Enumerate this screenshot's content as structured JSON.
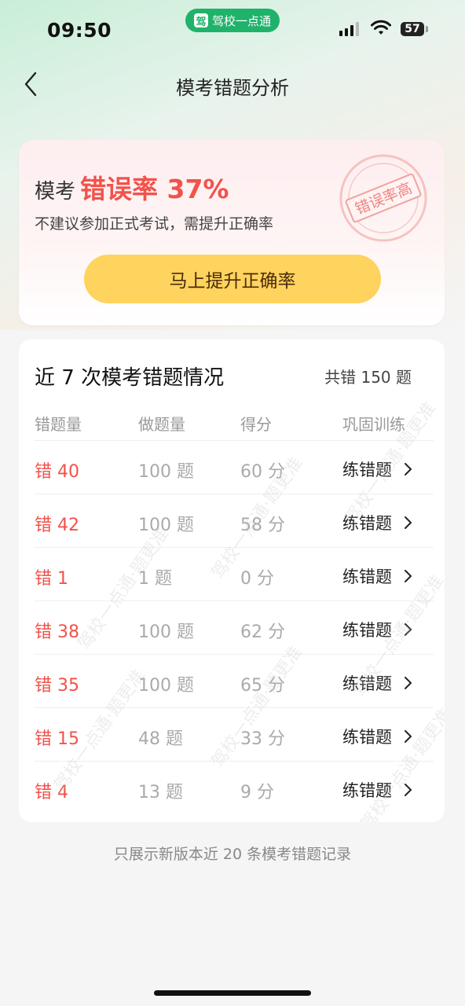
{
  "status": {
    "time": "09:50",
    "app_badge": "驾校一点通",
    "app_logo": "驾",
    "battery": "57"
  },
  "nav": {
    "title": "模考错题分析"
  },
  "hero": {
    "prefix": "模考",
    "rate": "错误率 37%",
    "subtitle": "不建议参加正式考试，需提升正确率",
    "stamp": "错误率高",
    "cta": "马上提升正确率",
    "accent_color": "#f2524b",
    "cta_color": "#fed35e"
  },
  "list": {
    "title": "近 7 次模考错题情况",
    "total": "共错 150 题",
    "columns": [
      "错题量",
      "做题量",
      "得分",
      "巩固训练"
    ],
    "rows": [
      {
        "wrong": "错 40",
        "count": "100 题",
        "score": "60 分",
        "action": "练错题"
      },
      {
        "wrong": "错 42",
        "count": "100 题",
        "score": "58 分",
        "action": "练错题"
      },
      {
        "wrong": "错 1",
        "count": "1 题",
        "score": "0 分",
        "action": "练错题"
      },
      {
        "wrong": "错 38",
        "count": "100 题",
        "score": "62 分",
        "action": "练错题"
      },
      {
        "wrong": "错 35",
        "count": "100 题",
        "score": "65 分",
        "action": "练错题"
      },
      {
        "wrong": "错 15",
        "count": "48 题",
        "score": "33 分",
        "action": "练错题"
      },
      {
        "wrong": "错 4",
        "count": "13 题",
        "score": "9 分",
        "action": "练错题"
      }
    ],
    "watermark": "驾校一点通·题更准"
  },
  "footnote": "只展示新版本近 20 条模考错题记录"
}
